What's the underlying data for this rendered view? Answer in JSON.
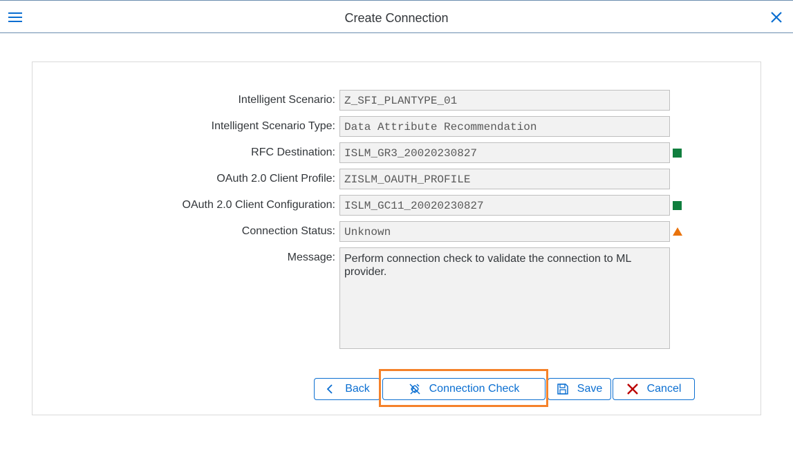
{
  "header": {
    "title": "Create Connection"
  },
  "form": {
    "fields": [
      {
        "label": "Intelligent Scenario:",
        "value": "Z_SFI_PLANTYPE_01"
      },
      {
        "label": "Intelligent Scenario Type:",
        "value": "Data Attribute Recommendation"
      },
      {
        "label": "RFC Destination:",
        "value": "ISLM_GR3_20020230827"
      },
      {
        "label": "OAuth 2.0 Client Profile:",
        "value": "ZISLM_OAUTH_PROFILE"
      },
      {
        "label": "OAuth 2.0 Client Configuration:",
        "value": "ISLM_GC11_20020230827"
      },
      {
        "label": "Connection Status:",
        "value": "Unknown"
      }
    ],
    "message": {
      "label": "Message:",
      "value": "Perform connection check to validate the connection to ML provider."
    }
  },
  "buttons": {
    "back": "Back",
    "connection_check": "Connection Check",
    "save": "Save",
    "cancel": "Cancel"
  },
  "colors": {
    "brand": "#0a6ed1",
    "success": "#107e3e",
    "warning": "#e9730c",
    "highlight": "#f5822a"
  }
}
